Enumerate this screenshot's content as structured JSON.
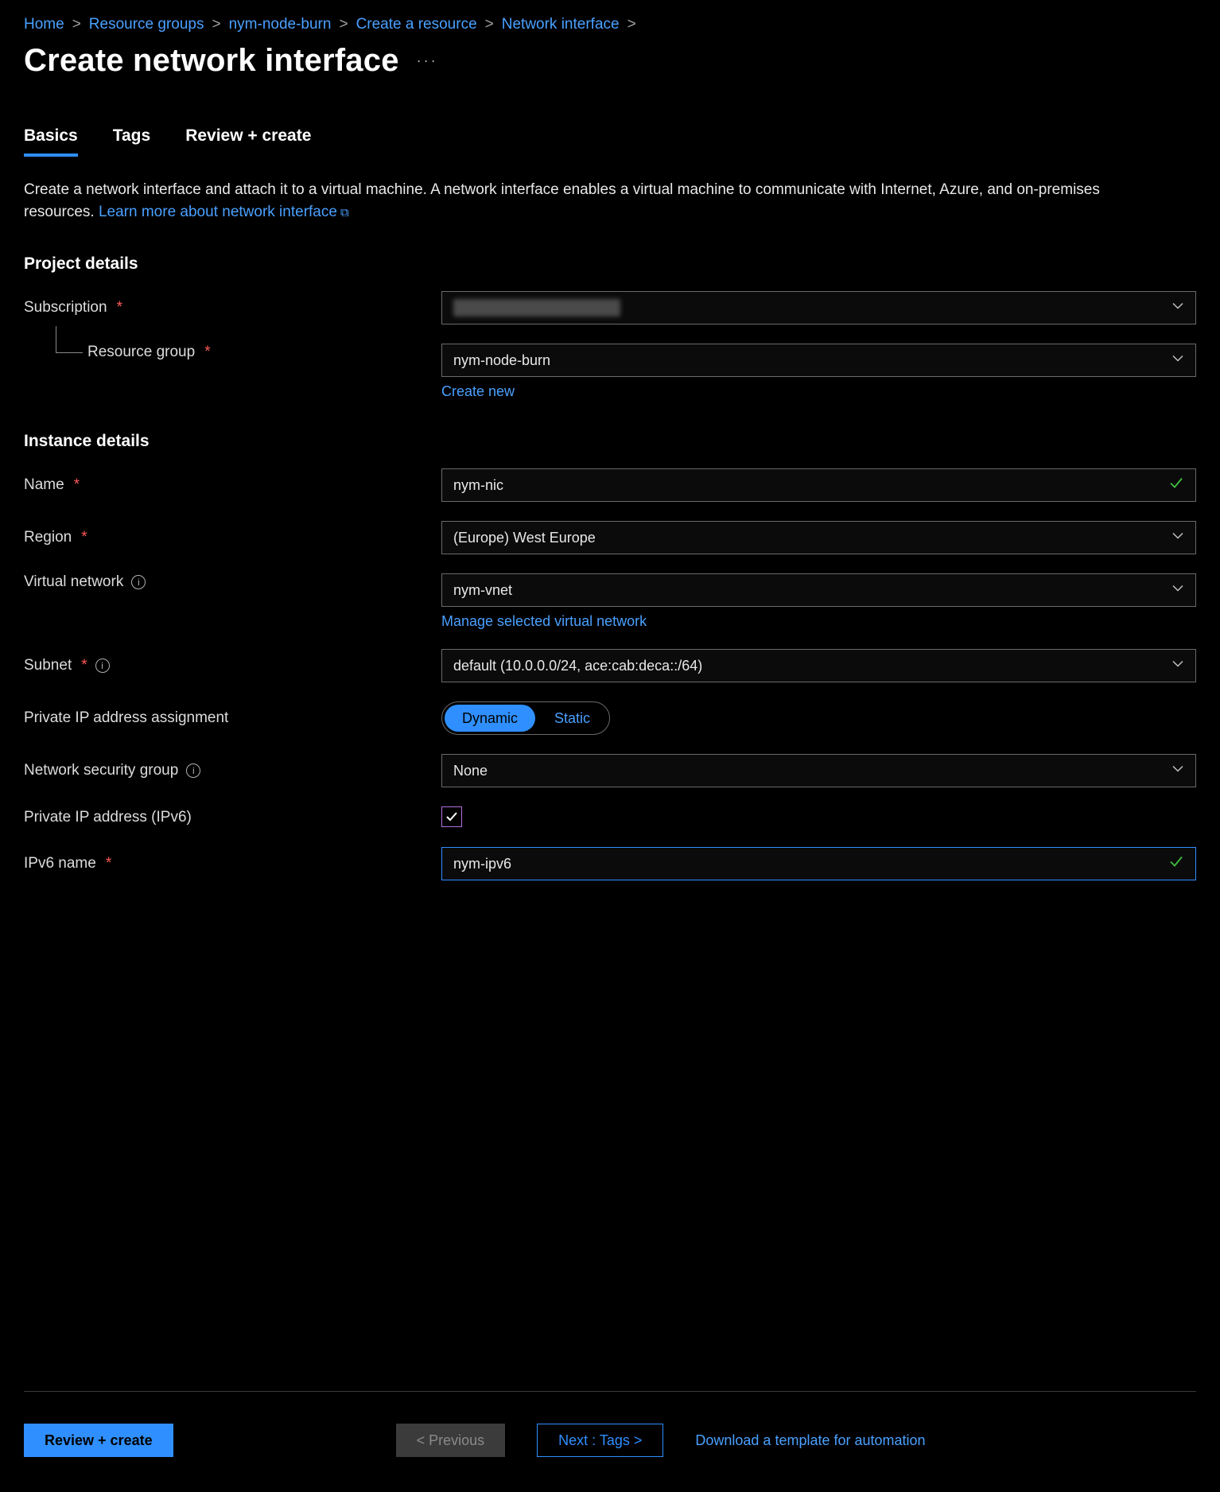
{
  "breadcrumb": {
    "items": [
      {
        "label": "Home"
      },
      {
        "label": "Resource groups"
      },
      {
        "label": "nym-node-burn"
      },
      {
        "label": "Create a resource"
      },
      {
        "label": "Network interface"
      }
    ]
  },
  "page_title": "Create network interface",
  "tabs": {
    "basics": "Basics",
    "tags": "Tags",
    "review": "Review + create"
  },
  "intro": {
    "text": "Create a network interface and attach it to a virtual machine. A network interface enables a virtual machine to communicate with Internet, Azure, and on-premises resources. ",
    "link": "Learn more about network interface"
  },
  "sections": {
    "project": "Project details",
    "instance": "Instance details"
  },
  "labels": {
    "subscription": "Subscription",
    "resource_group": "Resource group",
    "create_new": "Create new",
    "name": "Name",
    "region": "Region",
    "vnet": "Virtual network",
    "manage_vnet": "Manage selected virtual network",
    "subnet": "Subnet",
    "ip_assignment": "Private IP address assignment",
    "nsg": "Network security group",
    "ipv6_enable": "Private IP address (IPv6)",
    "ipv6_name": "IPv6 name"
  },
  "values": {
    "resource_group": "nym-node-burn",
    "name": "nym-nic",
    "region": "(Europe) West Europe",
    "vnet": "nym-vnet",
    "subnet": "default (10.0.0.0/24, ace:cab:deca::/64)",
    "nsg": "None",
    "ipv6_name": "nym-ipv6"
  },
  "ip_assign_options": {
    "dynamic": "Dynamic",
    "static": "Static"
  },
  "footer": {
    "review": "Review + create",
    "previous": "< Previous",
    "next": "Next : Tags >",
    "download": "Download a template for automation"
  }
}
